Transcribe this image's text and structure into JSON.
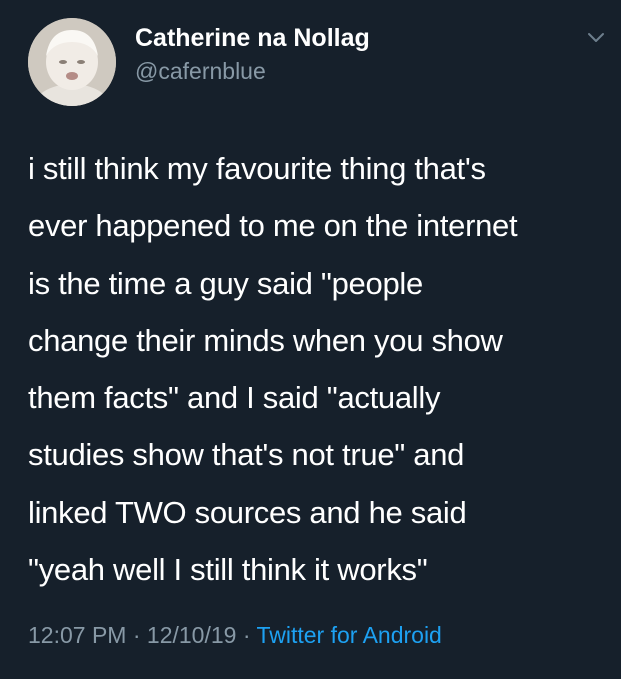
{
  "tweet": {
    "author": {
      "display_name": "Catherine na Nollag",
      "handle": "@cafernblue"
    },
    "text": "i still think my favourite thing that's\never happened to me on the internet\nis the time a guy said \"people\nchange their minds when you show\nthem facts\" and I said \"actually\nstudies show that's not true\" and\nlinked TWO sources and he said\n\"yeah well I still think it works\"",
    "time": "12:07 PM",
    "separator": "·",
    "date": "12/10/19",
    "source": "Twitter for Android",
    "menu_icon": "chevron-down-icon"
  },
  "colors": {
    "background": "#16202b",
    "primary_text": "#ffffff",
    "secondary_text": "#8899a6",
    "link": "#1da1f2"
  }
}
